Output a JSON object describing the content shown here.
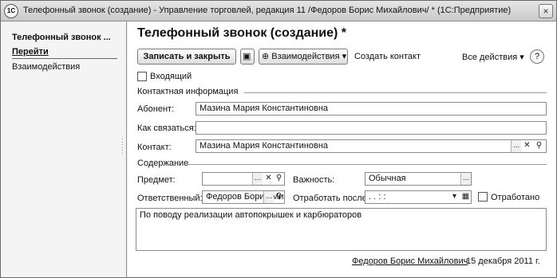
{
  "window": {
    "app_logo": "1С",
    "title": "Телефонный звонок (создание) - Управление торговлей, редакция 11 /Федоров Борис Михайлович/ * (1С:Предприятие)",
    "close_glyph": "×"
  },
  "sidebar": {
    "title": "Телефонный звонок ...",
    "nav_header": "Перейти",
    "items": [
      {
        "label": "Взаимодействия"
      }
    ]
  },
  "form": {
    "title": "Телефонный звонок (создание) *",
    "toolbar": {
      "save_close_label": "Записать и закрыть",
      "interactions_label": "Взаимодействия",
      "create_contact_label": "Создать контакт",
      "all_actions_label": "Все действия",
      "help_label": "?"
    },
    "incoming": {
      "label": "Входящий",
      "checked": false
    },
    "contact_section": {
      "title": "Контактная информация",
      "subscriber": {
        "label": "Абонент:",
        "value": "Мазина Мария Константиновна"
      },
      "how_to_contact": {
        "label": "Как связаться:",
        "value": ""
      },
      "contact": {
        "label": "Контакт:",
        "value": "Мазина Мария Константиновна"
      }
    },
    "content_section": {
      "title": "Содержание",
      "subject": {
        "label": "Предмет:",
        "value": ""
      },
      "importance": {
        "label": "Важность:",
        "value": "Обычная"
      },
      "responsible": {
        "label": "Ответственный:",
        "value": "Федоров Борис Михайлович"
      },
      "process_after": {
        "label": "Отработать после:",
        "value": ". .   : :"
      },
      "processed": {
        "label": "Отработано",
        "checked": false
      }
    },
    "description": "По поводу реализации автопокрышек и карбюраторов",
    "footer": {
      "author": "Федоров Борис Михайлович",
      "date": "15 декабря 2011 г."
    }
  },
  "icons": {
    "dots": "...",
    "clear": "✕",
    "search": "⚲",
    "dropdown": "▾",
    "calendar": "▦",
    "save": "▣",
    "interactions": "⊕"
  }
}
